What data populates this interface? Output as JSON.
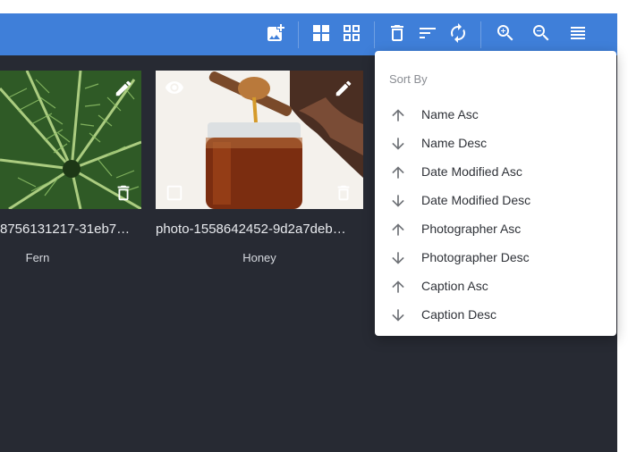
{
  "toolbar": {
    "buttons": [
      {
        "name": "add-image-button",
        "icon": "add-photo-icon"
      },
      {
        "name": "grid-large-view-button",
        "icon": "grid-large-icon"
      },
      {
        "name": "grid-small-view-button",
        "icon": "grid-small-icon"
      },
      {
        "name": "delete-button",
        "icon": "trash-icon"
      },
      {
        "name": "sort-button",
        "icon": "sort-icon"
      },
      {
        "name": "refresh-button",
        "icon": "refresh-icon"
      },
      {
        "name": "zoom-in-button",
        "icon": "zoom-in-icon"
      },
      {
        "name": "zoom-out-button",
        "icon": "zoom-out-icon"
      },
      {
        "name": "list-view-button",
        "icon": "list-icon"
      }
    ],
    "color": "#3f7fd9"
  },
  "gallery": {
    "cards": [
      {
        "filename": "8756131217-31eb7…",
        "caption": "Fern"
      },
      {
        "filename": "photo-1558642452-9d2a7deb…",
        "caption": "Honey"
      }
    ],
    "background": "#272a33"
  },
  "sort_menu": {
    "title": "Sort By",
    "items": [
      {
        "label": "Name Asc",
        "direction": "up"
      },
      {
        "label": "Name Desc",
        "direction": "down"
      },
      {
        "label": "Date Modified Asc",
        "direction": "up"
      },
      {
        "label": "Date Modified Desc",
        "direction": "down"
      },
      {
        "label": "Photographer Asc",
        "direction": "up"
      },
      {
        "label": "Photographer Desc",
        "direction": "down"
      },
      {
        "label": "Caption Asc",
        "direction": "up"
      },
      {
        "label": "Caption Desc",
        "direction": "down"
      }
    ]
  }
}
